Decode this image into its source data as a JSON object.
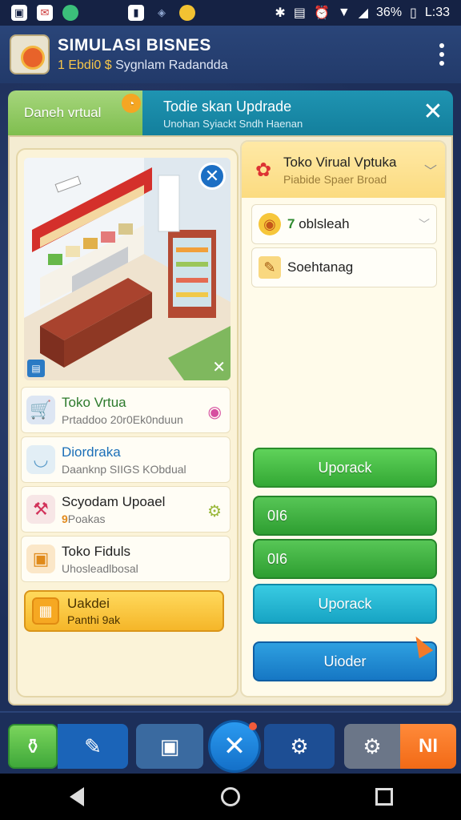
{
  "status_bar": {
    "battery": "36%",
    "time": "L:33",
    "icons": [
      "gallery-icon",
      "mail-icon",
      "circle-icon",
      "bookmark-icon",
      "shield-icon",
      "coin-icon",
      "bluetooth-icon",
      "nfc-icon",
      "alarm-icon",
      "wifi-icon",
      "signal-icon",
      "battery-icon"
    ]
  },
  "header": {
    "title": "SIMULASI BISNES",
    "subtitle_highlight": "1 Ebdi0 $",
    "subtitle": "Sygnlam Radandda"
  },
  "tabs": {
    "tab_left": "Daneh vrtual",
    "tab_right_title": "Todie skan Updrade",
    "tab_right_sub": "Unohan Syiackt Sndh Haenan"
  },
  "left_list": [
    {
      "title": "Toko Vrtua",
      "subtitle": "Prtaddoo 20r0Ek0nduun",
      "title_color": "#2c7a2c",
      "icon": "cart-icon"
    },
    {
      "title": "Diordraka",
      "subtitle": "Daanknp SIIGS KObdual",
      "title_color": "#1b6fb8",
      "icon": "bowl-icon"
    },
    {
      "title": "Scyodam Upoael",
      "subtitle": "Poakas",
      "subtitle_highlight": "9",
      "title_color": "#222222",
      "icon": "hammer-icon"
    },
    {
      "title": "Toko Fiduls",
      "subtitle": "Uhosleadlbosal",
      "title_color": "#222222",
      "icon": "box-icon"
    }
  ],
  "yellow_button": {
    "title": "Uakdei",
    "subtitle": "Panthi 9ak"
  },
  "right_panel": {
    "header_title": "Toko Virual Vptuka",
    "header_sub": "Piabide Spaer Broad",
    "items": [
      {
        "prefix": "7",
        "label": "oblsleah"
      },
      {
        "prefix": "",
        "label": "Soehtanag"
      }
    ],
    "buttons": [
      "Uporack",
      "0I6",
      "0I6",
      "Uporack",
      "Uioder"
    ]
  },
  "toolbar": {
    "last_label": "NI"
  },
  "colors": {
    "accent_green": "#33a834",
    "accent_cyan": "#17a4c4",
    "accent_blue": "#1677c4",
    "accent_orange": "#f26a16"
  }
}
